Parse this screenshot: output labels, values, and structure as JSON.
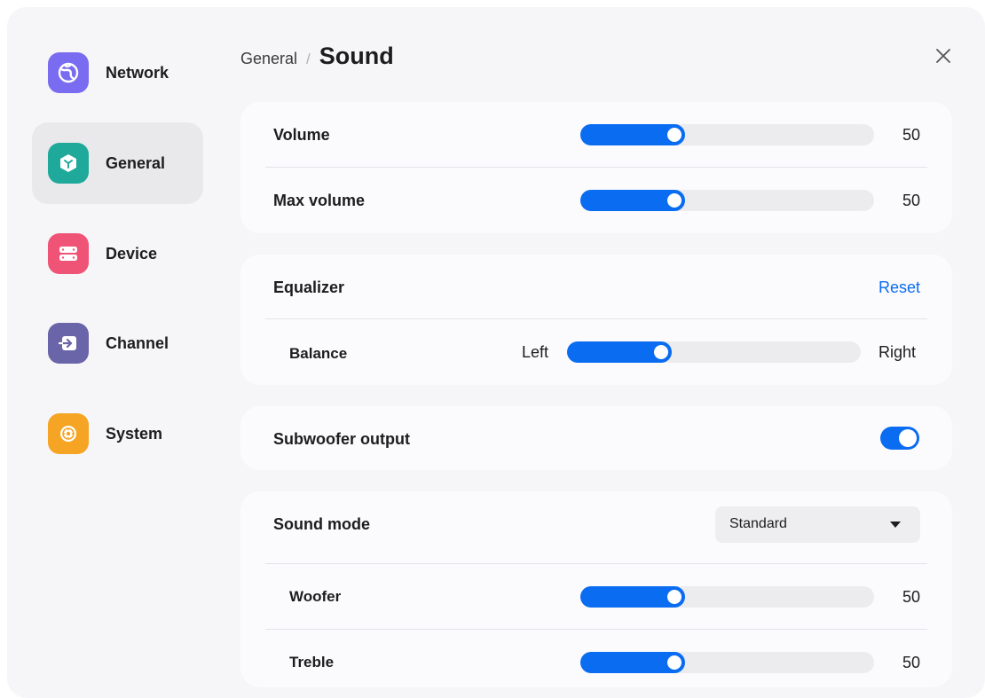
{
  "colors": {
    "accent": "#0a6cf0",
    "network_icon": "#7a6cf0",
    "general_icon": "#1ea99a",
    "device_icon": "#ef5477",
    "channel_icon": "#6a64a8",
    "system_icon": "#f5a523"
  },
  "sidebar": {
    "items": [
      {
        "label": "Network",
        "icon": "globe-icon"
      },
      {
        "label": "General",
        "icon": "cube-icon",
        "active": true
      },
      {
        "label": "Device",
        "icon": "server-icon"
      },
      {
        "label": "Channel",
        "icon": "input-arrow-icon"
      },
      {
        "label": "System",
        "icon": "gear-flower-icon"
      }
    ]
  },
  "header": {
    "parent": "General",
    "separator": "/",
    "title": "Sound",
    "close_icon": "close-icon"
  },
  "volume_card": {
    "volume": {
      "label": "Volume",
      "value": "50",
      "level": 0.32
    },
    "max_volume": {
      "label": "Max volume",
      "value": "50",
      "level": 0.32
    }
  },
  "equalizer_card": {
    "title": "Equalizer",
    "reset_label": "Reset",
    "balance": {
      "label": "Balance",
      "left": "Left",
      "right": "Right",
      "level": 0.32
    }
  },
  "subwoofer_card": {
    "label": "Subwoofer output",
    "enabled": true
  },
  "sound_mode_card": {
    "label": "Sound mode",
    "selected": "Standard",
    "woofer": {
      "label": "Woofer",
      "value": "50",
      "level": 0.32
    },
    "treble": {
      "label": "Treble",
      "value": "50",
      "level": 0.32
    }
  }
}
